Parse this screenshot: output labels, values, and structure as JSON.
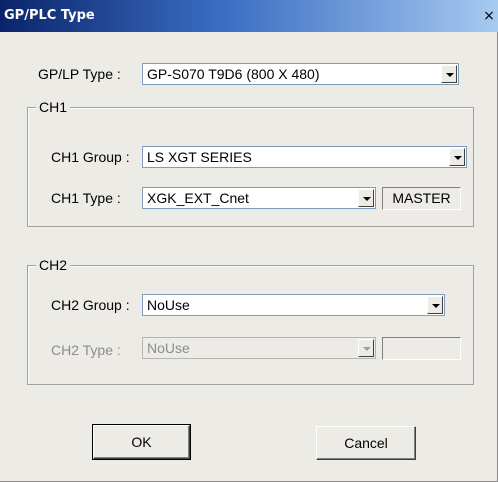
{
  "window": {
    "title": "GP/PLC Type",
    "close_glyph": "×"
  },
  "gp_lp": {
    "label": "GP/LP Type :",
    "value": "GP-S070  T9D6  (800 X 480)"
  },
  "ch1": {
    "legend": "CH1",
    "group_label": "CH1 Group :",
    "group_value": "LS XGT SERIES",
    "type_label": "CH1 Type :",
    "type_value": "XGK_EXT_Cnet",
    "role": "MASTER"
  },
  "ch2": {
    "legend": "CH2",
    "group_label": "CH2 Group :",
    "group_value": "NoUse",
    "type_label": "CH2 Type :",
    "type_value": "NoUse",
    "role": ""
  },
  "buttons": {
    "ok": "OK",
    "cancel": "Cancel"
  },
  "icons": {
    "close": "close-icon",
    "dropdown": "chevron-down-icon"
  }
}
